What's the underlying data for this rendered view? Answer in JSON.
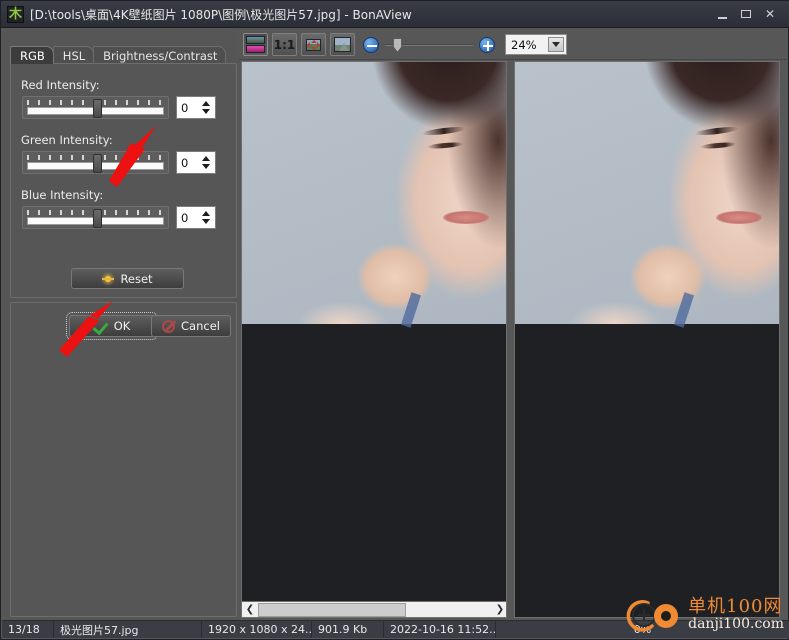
{
  "window": {
    "title": "[D:\\tools\\桌面\\4K壁纸图片 1080P\\图例\\极光图片57.jpg] - BonAView",
    "app_icon": "bonaview-app-icon",
    "buttons": {
      "minimize": "minimize-button",
      "maximize": "maximize-button",
      "close": "✕"
    }
  },
  "adjust_dialog": {
    "tabs": [
      {
        "label": "RGB",
        "active": true
      },
      {
        "label": "HSL",
        "active": false
      },
      {
        "label": "Brightness/Contrast",
        "active": false
      }
    ],
    "sliders": [
      {
        "label": "Red Intensity:",
        "value": "0",
        "position_pct": 50
      },
      {
        "label": "Green Intensity:",
        "value": "0",
        "position_pct": 50
      },
      {
        "label": "Blue Intensity:",
        "value": "0",
        "position_pct": 50
      }
    ],
    "reset_label": "Reset",
    "ok_label": "OK",
    "cancel_label": "Cancel"
  },
  "toolbar": {
    "compare_tooltip": "Compare view",
    "actual_size_label": "1:1",
    "fit_tooltip": "Fit to window",
    "picture_tooltip": "Original image",
    "zoom_out_label": "zoom-out-icon",
    "zoom_in_label": "zoom-in-icon",
    "zoom_slider_pct": 10,
    "zoom_value": "24%"
  },
  "panes": {
    "left": {
      "name": "original-preview",
      "scroll_left_arrow": "❮",
      "scroll_right_arrow": "❯"
    },
    "right": {
      "name": "adjusted-preview"
    }
  },
  "statusbar": {
    "index": "13/18",
    "filename": "极光图片57.jpg",
    "dimensions": "1920 x 1080 x 24...",
    "filesize": "901.9 Kb",
    "date": "2022-10-16 11:52...",
    "progress": "0%"
  },
  "watermark": {
    "cn": "单机100网",
    "en": "danji100.com",
    "accent": "#f08a33"
  },
  "colors": {
    "window_bg": "#565656",
    "titlebar": "#32353d",
    "statusbar": "#3b3d44",
    "annotation": "#ee1111"
  }
}
